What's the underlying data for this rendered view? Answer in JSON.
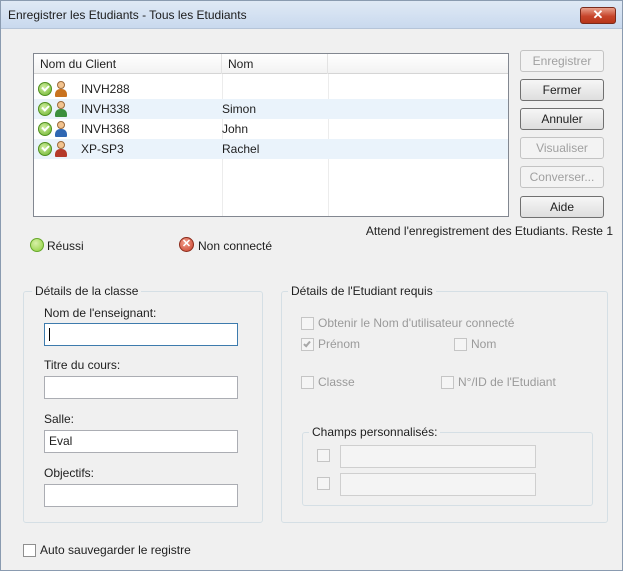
{
  "window": {
    "title": "Enregistrer les Etudiants - Tous les Etudiants",
    "close_glyph": "✕"
  },
  "list": {
    "columns": [
      "Nom du Client",
      "Nom"
    ],
    "rows": [
      {
        "client": "INVH288",
        "nom": "",
        "status": "réussi",
        "avatar_color": "#c9731f"
      },
      {
        "client": "INVH338",
        "nom": "Simon",
        "status": "réussi",
        "avatar_color": "#3c8f3c"
      },
      {
        "client": "INVH368",
        "nom": "John",
        "status": "réussi",
        "avatar_color": "#2f67b3"
      },
      {
        "client": "XP-SP3",
        "nom": "Rachel",
        "status": "réussi",
        "avatar_color": "#b53a2a"
      }
    ]
  },
  "buttons": {
    "enregistrer": "Enregistrer",
    "fermer": "Fermer",
    "annuler": "Annuler",
    "visualiser": "Visualiser",
    "converser": "Converser...",
    "aide": "Aide"
  },
  "status": "Attend l'enregistrement des Etudiants. Reste 1",
  "legend": {
    "ok": "Réussi",
    "error": "Non connecté",
    "error_glyph": "✕"
  },
  "class_details": {
    "title": "Détails de la classe",
    "teacher_label": "Nom de l'enseignant:",
    "teacher_value": "",
    "course_label": "Titre du cours:",
    "course_value": "",
    "room_label": "Salle:",
    "room_value": "Eval",
    "objectives_label": "Objectifs:",
    "objectives_value": ""
  },
  "student_details": {
    "title": "Détails de l'Etudiant requis",
    "logged_user": "Obtenir le Nom d'utilisateur connecté",
    "prenom": "Prénom",
    "nom": "Nom",
    "classe": "Classe",
    "student_id": "N°/ID de l'Etudiant",
    "custom_fields_title": "Champs personnalisés:"
  },
  "autosave": "Auto sauvegarder le registre",
  "colors": {
    "accent": "#3d7bad",
    "ok": "#6bb22b",
    "error": "#c8402a",
    "close": "#c7452b"
  }
}
